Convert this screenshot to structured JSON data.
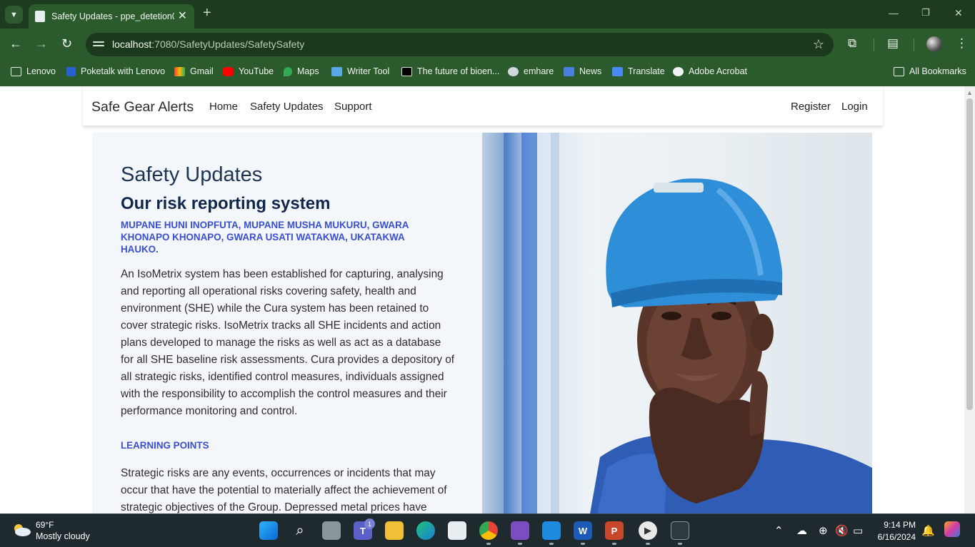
{
  "browser": {
    "tab_title": "Safety Updates - ppe_detetion0",
    "new_tab_symbol": "+",
    "url_host": "localhost",
    "url_path": ":7080/SafetyUpdates/SafetySafety",
    "colors": {
      "frame": "#1d3b1f",
      "toolbar": "#2b5a2d",
      "omnibox": "#1b3a1d"
    },
    "bookmarks": [
      {
        "label": "Lenovo",
        "icon": "folder-icon"
      },
      {
        "label": "Poketalk with Lenovo",
        "icon": "poketalk-icon"
      },
      {
        "label": "Gmail",
        "icon": "gmail-icon"
      },
      {
        "label": "YouTube",
        "icon": "youtube-icon"
      },
      {
        "label": "Maps",
        "icon": "maps-icon"
      },
      {
        "label": "Writer Tool",
        "icon": "writer-icon"
      },
      {
        "label": "The future of bioen...",
        "icon": "w-icon"
      },
      {
        "label": "emhare",
        "icon": "globe-icon"
      },
      {
        "label": "News",
        "icon": "news-icon"
      },
      {
        "label": "Translate",
        "icon": "translate-icon"
      },
      {
        "label": "Adobe Acrobat",
        "icon": "acrobat-icon"
      }
    ],
    "all_bookmarks": "All Bookmarks"
  },
  "site": {
    "brand": "Safe Gear Alerts",
    "nav": {
      "home": "Home",
      "safety_updates": "Safety Updates",
      "support": "Support",
      "register": "Register",
      "login": "Login"
    }
  },
  "content": {
    "eyebrow": "Safety Updates",
    "heading": "Our risk reporting system",
    "subheading": "MUPANE HUNI INOPFUTA, MUPANE MUSHA MUKURU, GWARA KHONAPO KHONAPO, GWARA USATI WATAKWA, UKATAKWA HAUKO.",
    "paragraph1": "An IsoMetrix system has been established for capturing, analysing and reporting all operational risks covering safety, health and environment (SHE) while the Cura system has been retained to cover strategic risks. IsoMetrix tracks all SHE incidents and action plans developed to manage the risks as well as act as a database for all SHE baseline risk assessments. Cura provides a depository of all strategic risks, identified control measures, individuals assigned with the responsibility to accomplish the control measures and their performance monitoring and control.",
    "learning_label": "LEARNING POINTS",
    "paragraph2": "Strategic risks are any events, occurrences or incidents that may occur that have the potential to materially affect the achievement of strategic objectives of the Group. Depressed metal prices have",
    "colors": {
      "accent": "#3a4fd0",
      "panel": "#f3f7fc",
      "heading": "#10264a"
    }
  },
  "taskbar": {
    "weather_temp": "69°F",
    "weather_desc": "Mostly cloudy",
    "teams_badge": "1",
    "time": "9:14 PM",
    "date": "6/16/2024"
  }
}
